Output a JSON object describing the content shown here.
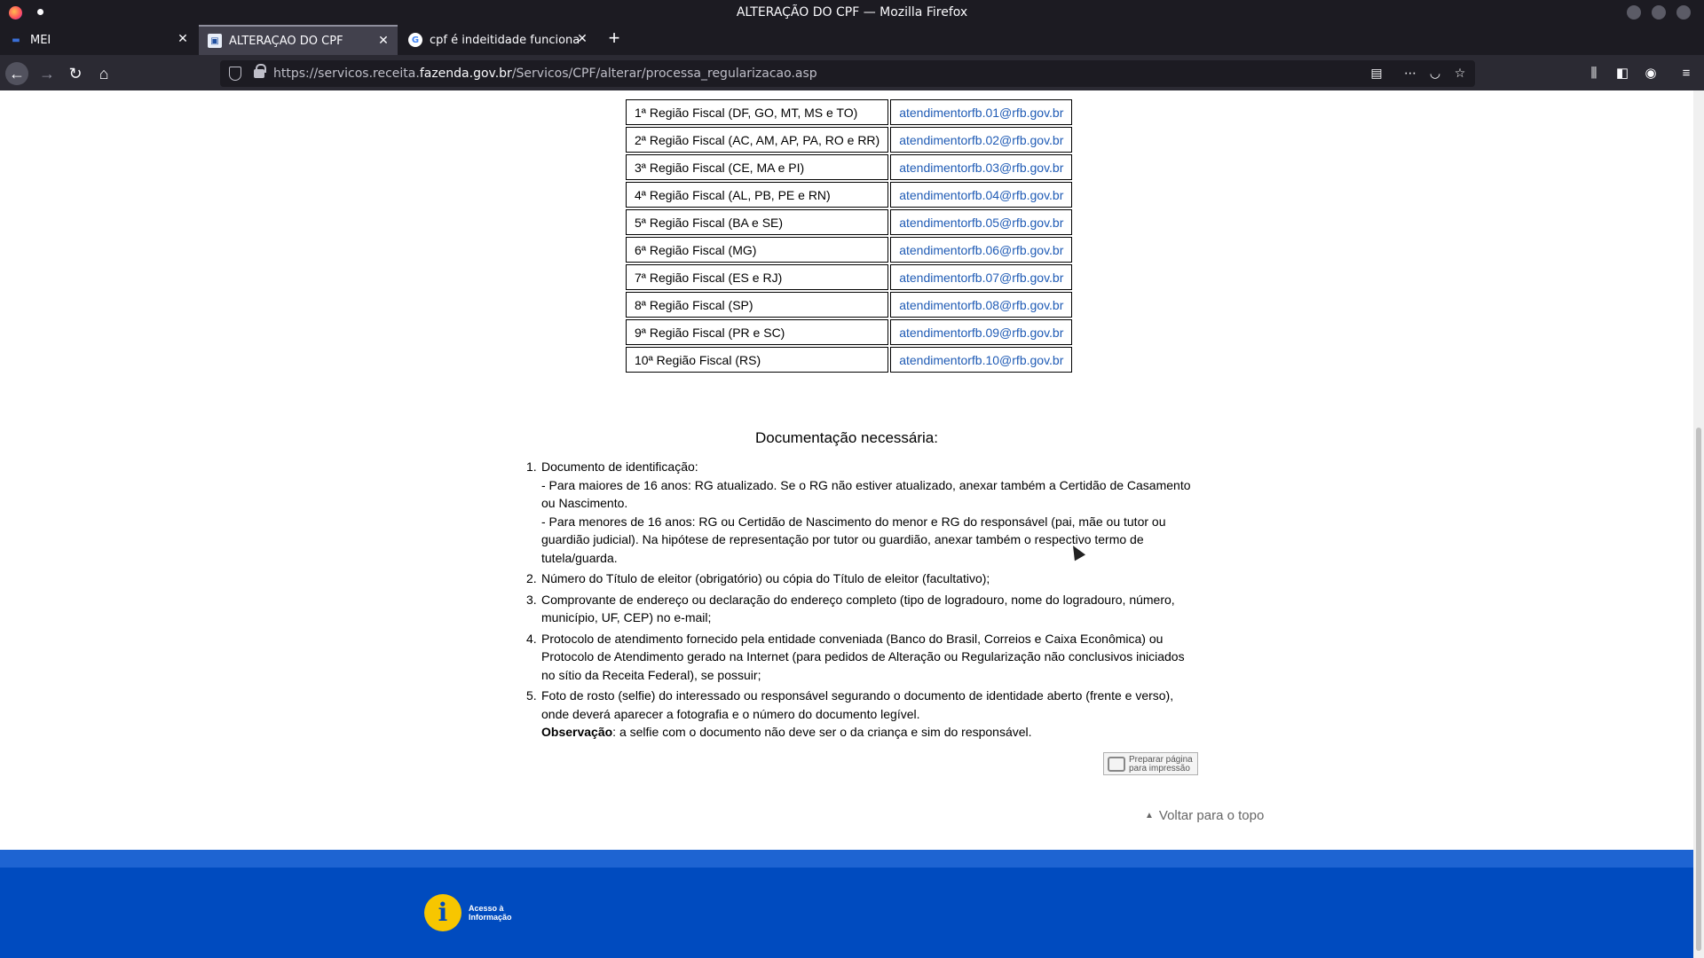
{
  "window": {
    "title": "ALTERAÇÃO DO CPF — Mozilla Firefox"
  },
  "tabs": [
    {
      "label": "MEI",
      "favicon": "mei-icon"
    },
    {
      "label": "ALTERAÇÃO DO CPF",
      "favicon": "receita-icon"
    },
    {
      "label": "cpf é indeitidade funciona",
      "favicon": "google-icon"
    }
  ],
  "toolbar": {
    "url_prefix": "https://servicos.receita.",
    "url_domain": "fazenda.gov.br",
    "url_path": "/Servicos/CPF/alterar/processa_regularizacao.asp"
  },
  "regions": [
    {
      "region": "1ª Região Fiscal (DF, GO, MT, MS e TO)",
      "email": "atendimentorfb.01@rfb.gov.br"
    },
    {
      "region": "2ª Região Fiscal (AC, AM, AP, PA, RO e RR)",
      "email": "atendimentorfb.02@rfb.gov.br"
    },
    {
      "region": "3ª Região Fiscal (CE, MA e PI)",
      "email": "atendimentorfb.03@rfb.gov.br"
    },
    {
      "region": "4ª Região Fiscal (AL, PB, PE e RN)",
      "email": "atendimentorfb.04@rfb.gov.br"
    },
    {
      "region": "5ª Região Fiscal (BA e SE)",
      "email": "atendimentorfb.05@rfb.gov.br"
    },
    {
      "region": "6ª Região Fiscal (MG)",
      "email": "atendimentorfb.06@rfb.gov.br"
    },
    {
      "region": "7ª Região Fiscal (ES e RJ)",
      "email": "atendimentorfb.07@rfb.gov.br"
    },
    {
      "region": "8ª Região Fiscal (SP)",
      "email": "atendimentorfb.08@rfb.gov.br"
    },
    {
      "region": "9ª Região Fiscal (PR e SC)",
      "email": "atendimentorfb.09@rfb.gov.br"
    },
    {
      "region": "10ª Região Fiscal (RS)",
      "email": "atendimentorfb.10@rfb.gov.br"
    }
  ],
  "documentation": {
    "title": "Documentação necessária:",
    "items": [
      {
        "num": "1.",
        "lines": [
          "Documento de identificação:",
          "- Para maiores de 16 anos: RG atualizado. Se o RG não estiver atualizado, anexar também a Certidão de Casamento ou Nascimento.",
          "- Para menores de 16 anos: RG ou Certidão de Nascimento do menor e RG do responsável (pai, mãe ou tutor ou guardião judicial). Na hipótese de representação por tutor ou guardião, anexar também o respectivo termo de tutela/guarda."
        ]
      },
      {
        "num": "2.",
        "lines": [
          "Número do Título de eleitor (obrigatório) ou cópia do Título de eleitor (facultativo);"
        ]
      },
      {
        "num": "3.",
        "lines": [
          "Comprovante de endereço ou declaração do endereço completo (tipo de logradouro, nome do logradouro, número, município, UF, CEP) no e-mail;"
        ]
      },
      {
        "num": "4.",
        "lines": [
          "Protocolo de atendimento fornecido pela entidade conveniada (Banco do Brasil, Correios e Caixa Econômica) ou Protocolo de Atendimento gerado na Internet (para pedidos de Alteração ou Regularização não conclusivos iniciados no sítio da Receita Federal), se possuir;"
        ]
      },
      {
        "num": "5.",
        "lines": [
          "Foto de rosto (selfie) do interessado ou responsável segurando o documento de identidade aberto (frente e verso), onde deverá aparecer a fotografia e o número do documento legível."
        ]
      }
    ],
    "note_label": "Observação",
    "note_text": ": a selfie com o documento não deve ser o da criança e sim do responsável."
  },
  "print_button": {
    "line1": "Preparar página",
    "line2": "para impressão"
  },
  "back_to_top": "Voltar para o topo",
  "footer": {
    "logo_glyph": "i",
    "logo_line1": "Acesso à",
    "logo_line2": "Informação"
  }
}
